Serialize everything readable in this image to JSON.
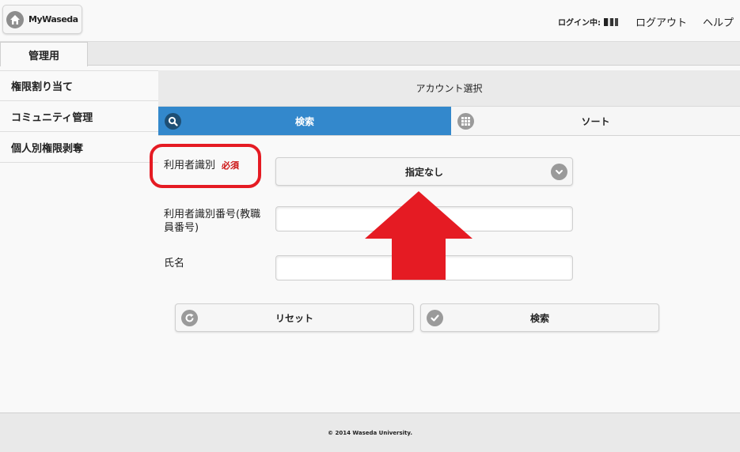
{
  "header": {
    "home_label": "MyWaseda",
    "login_status": "ログイン中:",
    "logout_label": "ログアウト",
    "help_label": "ヘルプ"
  },
  "tabs": [
    {
      "label": "管理用",
      "active": true
    }
  ],
  "sidebar": {
    "items": [
      {
        "label": "権限割り当て"
      },
      {
        "label": "コミュニティ管理"
      },
      {
        "label": "個人別権限剥奪"
      }
    ]
  },
  "main": {
    "title": "アカウント選択",
    "segment": {
      "search_label": "検索",
      "sort_label": "ソート",
      "active": "search"
    },
    "form": {
      "user_type": {
        "label": "利用者識別",
        "required_label": "必須",
        "selected_value": "指定なし"
      },
      "user_id": {
        "label": "利用者識別番号(教職員番号)",
        "value": ""
      },
      "name": {
        "label": "氏名",
        "value": ""
      }
    },
    "buttons": {
      "reset_label": "リセット",
      "search_label": "検索"
    }
  },
  "annotation": {
    "callout_color": "#e51b23",
    "arrow_color": "#e51b23"
  },
  "footer": {
    "copyright": "© 2014 Waseda University."
  },
  "colors": {
    "accent": "#3388cc",
    "required": "#cc1111"
  }
}
